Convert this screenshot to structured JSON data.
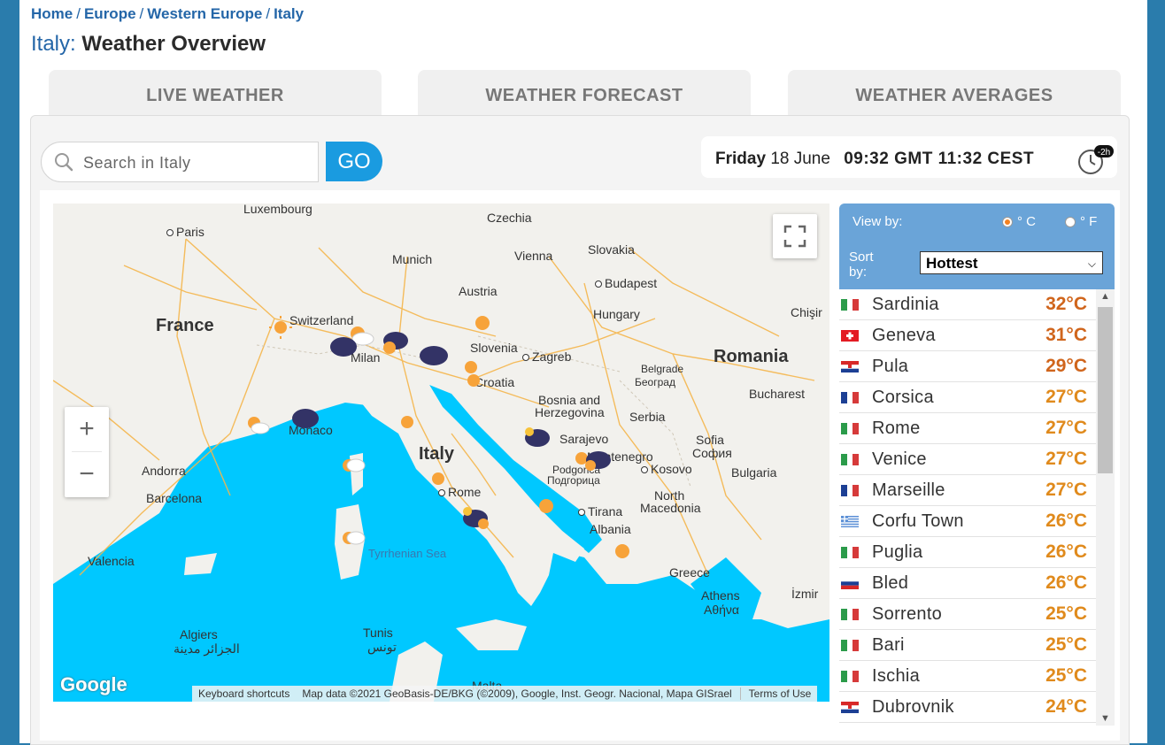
{
  "breadcrumb": [
    "Home",
    "Europe",
    "Western Europe",
    "Italy"
  ],
  "page_title": {
    "country": "Italy:",
    "rest": "Weather Overview"
  },
  "tabs": [
    "LIVE WEATHER",
    "WEATHER FORECAST",
    "WEATHER AVERAGES"
  ],
  "search": {
    "placeholder": "Search in Italy",
    "value": "",
    "go_label": "GO"
  },
  "datetime": {
    "day": "Friday",
    "date": "18 June",
    "times": "09:32 GMT 11:32 CEST",
    "offset_badge": "-2h"
  },
  "map": {
    "labels": [
      {
        "text": "Luxembourg",
        "kind": "city"
      },
      {
        "text": "Czechia",
        "kind": "city"
      },
      {
        "text": "Paris",
        "kind": "cap"
      },
      {
        "text": "Munich",
        "kind": "city"
      },
      {
        "text": "Vienna",
        "kind": "cap"
      },
      {
        "text": "Slovakia",
        "kind": "city"
      },
      {
        "text": "Budapest",
        "kind": "cap"
      },
      {
        "text": "Austria",
        "kind": "city"
      },
      {
        "text": "France",
        "kind": "country"
      },
      {
        "text": "Switzerland",
        "kind": "city"
      },
      {
        "text": "Hungary",
        "kind": "city"
      },
      {
        "text": "Chişir",
        "kind": "city"
      },
      {
        "text": "Slovenia",
        "kind": "city"
      },
      {
        "text": "Milan",
        "kind": "city"
      },
      {
        "text": "Zagreb",
        "kind": "cap"
      },
      {
        "text": "Romania",
        "kind": "country"
      },
      {
        "text": "Croatia",
        "kind": "city"
      },
      {
        "text": "Belgrade",
        "kind": "city"
      },
      {
        "text": "Београд",
        "kind": "city"
      },
      {
        "text": "Bosnia and",
        "kind": "city"
      },
      {
        "text": "Herzegovina",
        "kind": "city"
      },
      {
        "text": "Bucharest",
        "kind": "city"
      },
      {
        "text": "Serbia",
        "kind": "city"
      },
      {
        "text": "Monaco",
        "kind": "city"
      },
      {
        "text": "Sarajevo",
        "kind": "city"
      },
      {
        "text": "Sofia",
        "kind": "city"
      },
      {
        "text": "София",
        "kind": "city"
      },
      {
        "text": "Italy",
        "kind": "country"
      },
      {
        "text": "Montenegro",
        "kind": "city"
      },
      {
        "text": "Podgorica",
        "kind": "city"
      },
      {
        "text": "Подгорица",
        "kind": "city"
      },
      {
        "text": "Kosovo",
        "kind": "cap"
      },
      {
        "text": "Bulgaria",
        "kind": "city"
      },
      {
        "text": "Andorra",
        "kind": "city"
      },
      {
        "text": "Rome",
        "kind": "cap"
      },
      {
        "text": "North",
        "kind": "city"
      },
      {
        "text": "Macedonia",
        "kind": "city"
      },
      {
        "text": "Barcelona",
        "kind": "city"
      },
      {
        "text": "Tirana",
        "kind": "cap"
      },
      {
        "text": "Albania",
        "kind": "city"
      },
      {
        "text": "Valencia",
        "kind": "city"
      },
      {
        "text": "Tyrrhenian Sea",
        "kind": "sea"
      },
      {
        "text": "Greece",
        "kind": "city"
      },
      {
        "text": "Athens",
        "kind": "city"
      },
      {
        "text": "Αθήνα",
        "kind": "city"
      },
      {
        "text": "İzmir",
        "kind": "city"
      },
      {
        "text": "Algiers",
        "kind": "city"
      },
      {
        "text": "الجزائر مدينة",
        "kind": "city"
      },
      {
        "text": "Tunis",
        "kind": "city"
      },
      {
        "text": "تونس",
        "kind": "city"
      },
      {
        "text": "Malta",
        "kind": "city"
      }
    ],
    "google_logo": "Google",
    "attribution": [
      "Keyboard shortcuts",
      "Map data ©2021 GeoBasis-DE/BKG (©2009), Google, Inst. Geogr. Nacional, Mapa GISrael",
      "Terms of Use"
    ],
    "zoom_in": "+",
    "zoom_out": "−"
  },
  "sidebar": {
    "view_by_label": "View by:",
    "unit_c": "° C",
    "unit_f": "° F",
    "selected_unit": "C",
    "sort_label": "Sort by:",
    "sort_value": "Hottest",
    "colors": {
      "hot": "#d0651c",
      "warm": "#e08a1c"
    },
    "rows": [
      {
        "city": "Sardinia",
        "temp": "32°C",
        "flag": "it"
      },
      {
        "city": "Geneva",
        "temp": "31°C",
        "flag": "ch"
      },
      {
        "city": "Pula",
        "temp": "29°C",
        "flag": "hr"
      },
      {
        "city": "Corsica",
        "temp": "27°C",
        "flag": "fr"
      },
      {
        "city": "Rome",
        "temp": "27°C",
        "flag": "it"
      },
      {
        "city": "Venice",
        "temp": "27°C",
        "flag": "it"
      },
      {
        "city": "Marseille",
        "temp": "27°C",
        "flag": "fr"
      },
      {
        "city": "Corfu Town",
        "temp": "26°C",
        "flag": "gr"
      },
      {
        "city": "Puglia",
        "temp": "26°C",
        "flag": "it"
      },
      {
        "city": "Bled",
        "temp": "26°C",
        "flag": "si"
      },
      {
        "city": "Sorrento",
        "temp": "25°C",
        "flag": "it"
      },
      {
        "city": "Bari",
        "temp": "25°C",
        "flag": "it"
      },
      {
        "city": "Ischia",
        "temp": "25°C",
        "flag": "it"
      },
      {
        "city": "Dubrovnik",
        "temp": "24°C",
        "flag": "hr"
      }
    ]
  }
}
